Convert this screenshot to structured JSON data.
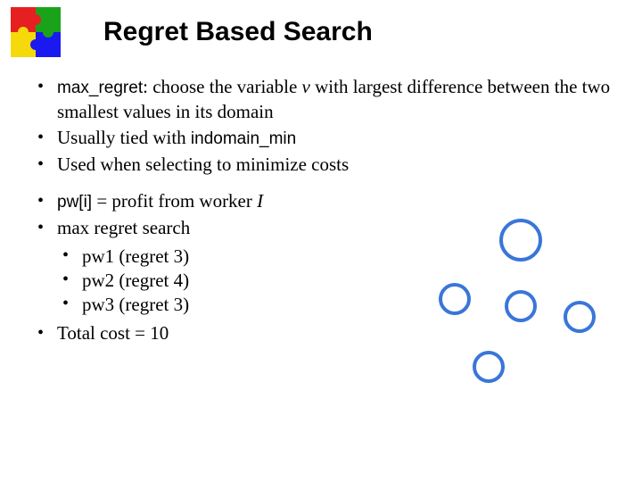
{
  "title": "Regret Based Search",
  "bullets": {
    "b1_code": "max_regret",
    "b1_rest": ": choose the variable ",
    "b1_var": "v",
    "b1_rest2": " with largest difference between the two smallest values in its domain",
    "b2_a": "Usually tied with ",
    "b2_code": "indomain_min",
    "b3": "Used when selecting to minimize costs",
    "b4_code": "pw[i]",
    "b4_rest": " = profit from worker ",
    "b4_var": "I",
    "b5": "max regret search",
    "sub1": "pw1 (regret 3)",
    "sub2": "pw2 (regret 4)",
    "sub3": "pw3 (regret 3)",
    "b6": "Total cost = 10"
  }
}
